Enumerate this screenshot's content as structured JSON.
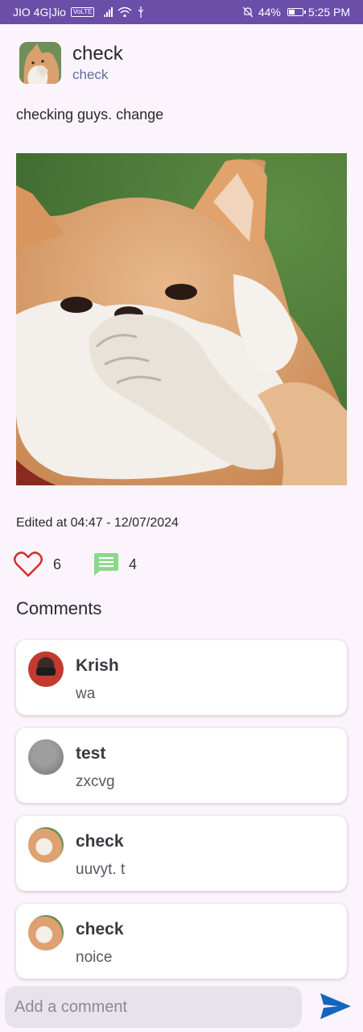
{
  "status_bar": {
    "carrier": "JIO 4G|Jio",
    "volte": "VoLTE",
    "battery": "44%",
    "battery_level": 0.44,
    "time": "5:25 PM"
  },
  "post": {
    "author_name": "check",
    "author_handle": "check",
    "text": "checking guys. change",
    "edited": "Edited at 04:47 - 12/07/2024",
    "likes": "6",
    "comments_count": "4"
  },
  "comments_section": {
    "title": "Comments",
    "items": [
      {
        "name": "Krish",
        "text": "wa"
      },
      {
        "name": "test",
        "text": "zxcvg"
      },
      {
        "name": "check",
        "text": "uuvyt.  t"
      },
      {
        "name": "check",
        "text": "noice"
      }
    ]
  },
  "input": {
    "placeholder": "Add a comment"
  },
  "colors": {
    "status_bar": "#6a4ea8",
    "like": "#d32f2f",
    "comment": "#8bd88b",
    "send": "#1565c0",
    "background": "#fcf4fc"
  },
  "icons": {
    "like": "heart-outline-icon",
    "comment": "chat-bubble-icon",
    "send": "send-arrow-icon"
  }
}
